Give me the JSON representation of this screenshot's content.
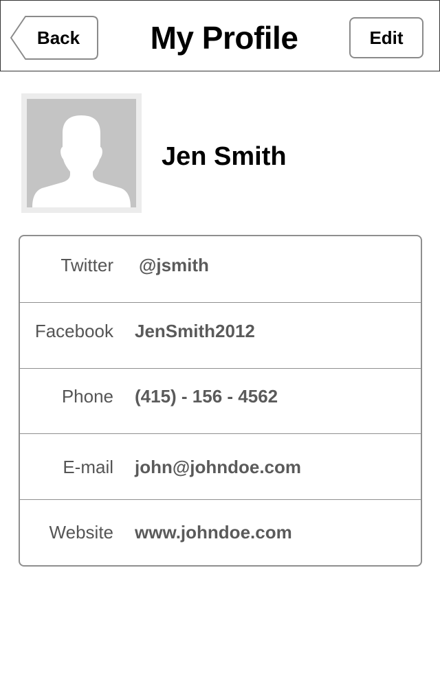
{
  "navbar": {
    "back_label": "Back",
    "title": "My Profile",
    "edit_label": "Edit"
  },
  "profile": {
    "name": "Jen Smith",
    "avatar_icon": "person-silhouette-icon"
  },
  "info": {
    "rows": [
      {
        "label": "Twitter",
        "value": "@jsmith"
      },
      {
        "label": "Facebook",
        "value": "JenSmith2012"
      },
      {
        "label": "Phone",
        "value": "(415) - 156 - 4562"
      },
      {
        "label": "E-mail",
        "value": "john@johndoe.com"
      },
      {
        "label": "Website",
        "value": "www.johndoe.com"
      }
    ]
  },
  "colors": {
    "border": "#8e8e8e",
    "label_text": "#555555",
    "value_text": "#5a5a5a",
    "avatar_bg": "#c4c4c4",
    "avatar_frame": "#ececec"
  }
}
